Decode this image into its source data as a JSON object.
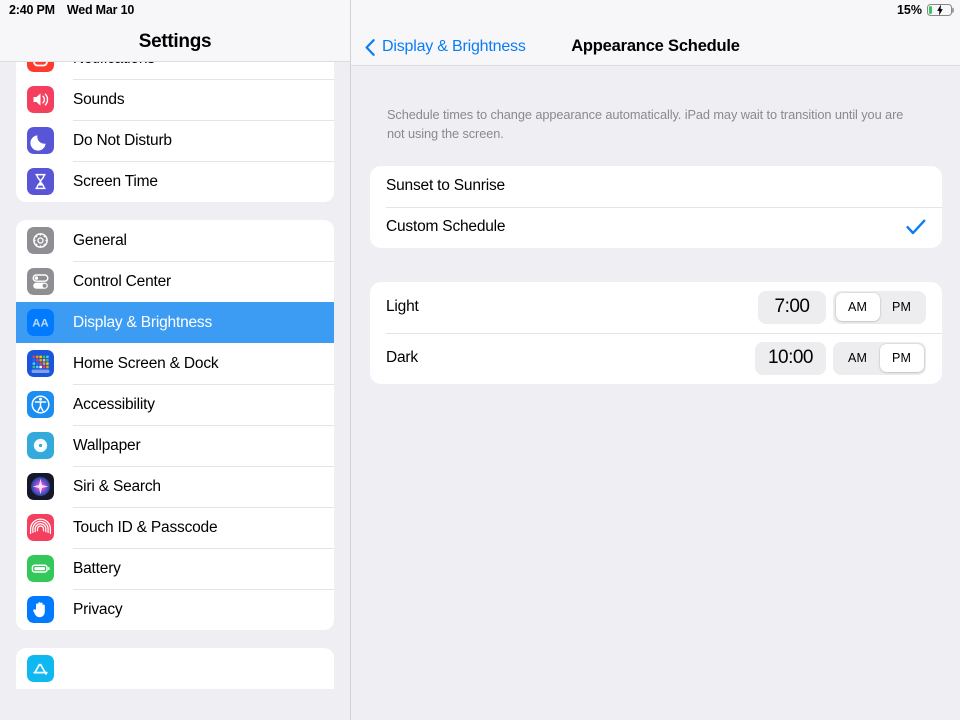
{
  "status_bar": {
    "time": "2:40 PM",
    "date": "Wed Mar 10",
    "battery_percent": "15%",
    "battery_level": 15,
    "battery_charging": true,
    "battery_color": "#34c759"
  },
  "sidebar": {
    "title": "Settings",
    "selected_accent": "#3c9cf4",
    "groups": [
      {
        "clipped": "top",
        "items": [
          {
            "label": "Notifications",
            "icon": "notifications-icon",
            "icon_color": "#ff3b30",
            "selected": false
          },
          {
            "label": "Sounds",
            "icon": "sounds-icon",
            "icon_color": "#f43f5e",
            "selected": false
          },
          {
            "label": "Do Not Disturb",
            "icon": "do-not-disturb-icon",
            "icon_color": "#5856d6",
            "selected": false
          },
          {
            "label": "Screen Time",
            "icon": "screen-time-icon",
            "icon_color": "#5856d6",
            "selected": false
          }
        ]
      },
      {
        "clipped": "none",
        "items": [
          {
            "label": "General",
            "icon": "general-gear-icon",
            "icon_color": "#8e8e93",
            "selected": false
          },
          {
            "label": "Control Center",
            "icon": "control-center-icon",
            "icon_color": "#8e8e93",
            "selected": false
          },
          {
            "label": "Display & Brightness",
            "icon": "display-brightness-icon",
            "icon_color": "#007aff",
            "selected": true
          },
          {
            "label": "Home Screen & Dock",
            "icon": "home-screen-dock-icon",
            "icon_color": "#1a56db",
            "selected": false
          },
          {
            "label": "Accessibility",
            "icon": "accessibility-icon",
            "icon_color": "#1b8ef2",
            "selected": false
          },
          {
            "label": "Wallpaper",
            "icon": "wallpaper-icon",
            "icon_color": "#34aadc",
            "selected": false
          },
          {
            "label": "Siri & Search",
            "icon": "siri-search-icon",
            "icon_color": "#1c1c28",
            "selected": false
          },
          {
            "label": "Touch ID & Passcode",
            "icon": "touch-id-passcode-icon",
            "icon_color": "#f43f5e",
            "selected": false
          },
          {
            "label": "Battery",
            "icon": "battery-icon",
            "icon_color": "#34c759",
            "selected": false
          },
          {
            "label": "Privacy",
            "icon": "privacy-hand-icon",
            "icon_color": "#007aff",
            "selected": false
          }
        ]
      },
      {
        "clipped": "bottom",
        "items": [
          {
            "label": "",
            "icon": "app-store-icon",
            "icon_color": "#0fb9f0",
            "selected": false
          }
        ]
      }
    ]
  },
  "detail": {
    "back_label": "Display & Brightness",
    "title": "Appearance Schedule",
    "note": "Schedule times to change appearance automatically. iPad may wait to transition until you are not using the screen.",
    "mode_options": [
      {
        "label": "Sunset to Sunrise",
        "checked": false
      },
      {
        "label": "Custom Schedule",
        "checked": true
      }
    ],
    "check_color": "#0a7cf5",
    "times": [
      {
        "label": "Light",
        "time": "7:00",
        "am_label": "AM",
        "pm_label": "PM",
        "meridiem": "AM"
      },
      {
        "label": "Dark",
        "time": "10:00",
        "am_label": "AM",
        "pm_label": "PM",
        "meridiem": "PM"
      }
    ]
  }
}
